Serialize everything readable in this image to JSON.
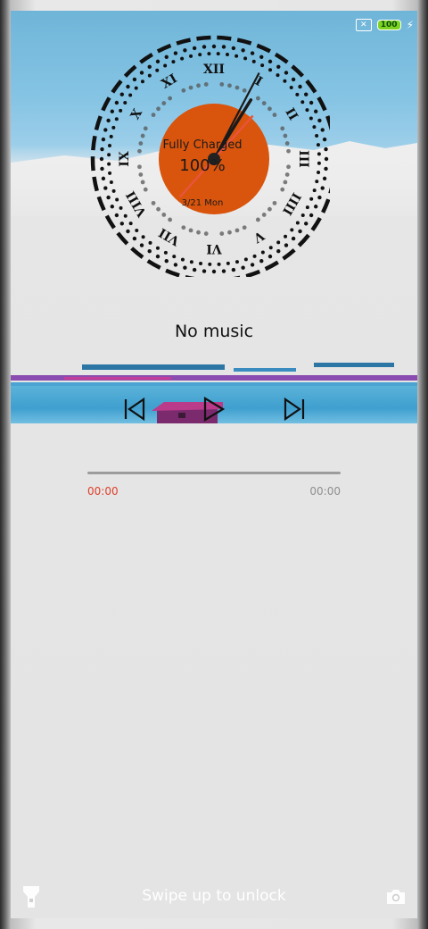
{
  "status_bar": {
    "sim_icon": "no-sim-icon",
    "battery_level": "100",
    "charging_icon": "lightning-bolt-icon",
    "battery_color": "#7ed321"
  },
  "clock": {
    "roman_numerals": [
      "XII",
      "I",
      "II",
      "III",
      "IIII",
      "V",
      "VI",
      "VII",
      "VIII",
      "IX",
      "X",
      "XI"
    ],
    "time": {
      "hour": 1,
      "minute": 4,
      "second": 37
    },
    "center_status": "Fully Charged",
    "center_percent": "100%",
    "center_date": "3/21 Mon",
    "accent_color": "#d9540c",
    "second_hand_color": "#e8543a"
  },
  "music": {
    "title": "No music",
    "previous_icon": "skip-previous-icon",
    "play_icon": "play-icon",
    "next_icon": "skip-next-icon",
    "elapsed": "00:00",
    "duration": "00:00",
    "progress": 0,
    "elapsed_color": "#e0402a"
  },
  "lockscreen": {
    "unlock_hint": "Swipe up to unlock",
    "left_shortcut_icon": "flashlight-icon",
    "right_shortcut_icon": "camera-icon"
  }
}
